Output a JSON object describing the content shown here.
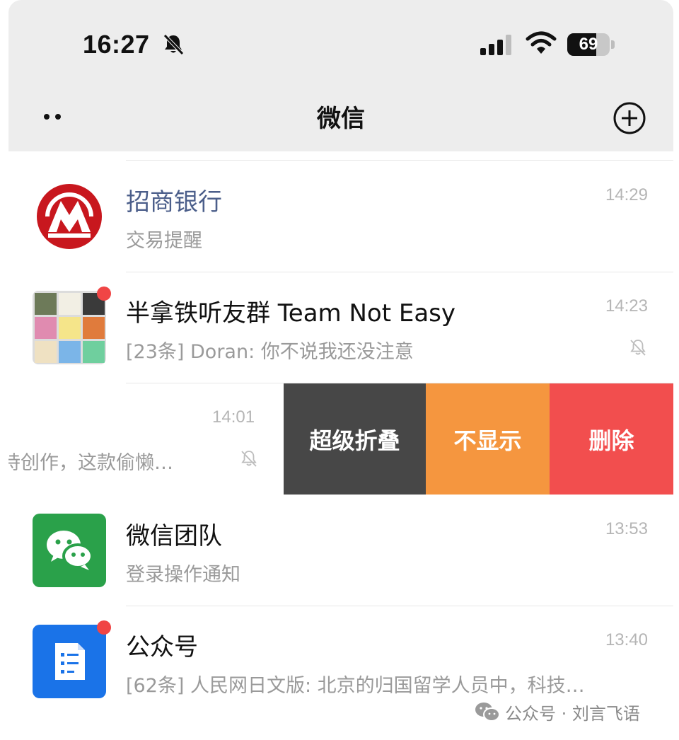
{
  "status_bar": {
    "time": "16:27",
    "battery": "69"
  },
  "nav": {
    "title": "微信"
  },
  "chats": [
    {
      "name": "招商银行",
      "preview": "交易提醒",
      "time": "14:29"
    },
    {
      "name": "半拿铁听友群 Team Not Easy",
      "preview": "[23条] Doran: 你不说我还没注意",
      "time": "14:23"
    },
    {
      "preview": "持创作，这款偷懒…",
      "time": "14:01"
    },
    {
      "name": "微信团队",
      "preview": "登录操作通知",
      "time": "13:53"
    },
    {
      "name": "公众号",
      "preview": "[62条] 人民网日文版: 北京的归国留学人员中，科技…",
      "time": "13:40"
    }
  ],
  "swipe_actions": {
    "fold": "超级折叠",
    "hide": "不显示",
    "delete": "删除"
  },
  "watermark": {
    "text": "公众号 · 刘言飞语"
  },
  "colors": {
    "topbar": "#ededed",
    "fold": "#474747",
    "hide": "#f5963f",
    "delete": "#f24e4e",
    "badge": "#f04545",
    "wechat_green": "#2aa14a",
    "official_blue": "#1a73e8",
    "bank_red": "#c8171e"
  },
  "icons": [
    "mute-icon",
    "signal-icon",
    "wifi-icon",
    "battery-icon",
    "dots-icon",
    "plus-circle-icon",
    "wechat-icon",
    "document-icon"
  ]
}
